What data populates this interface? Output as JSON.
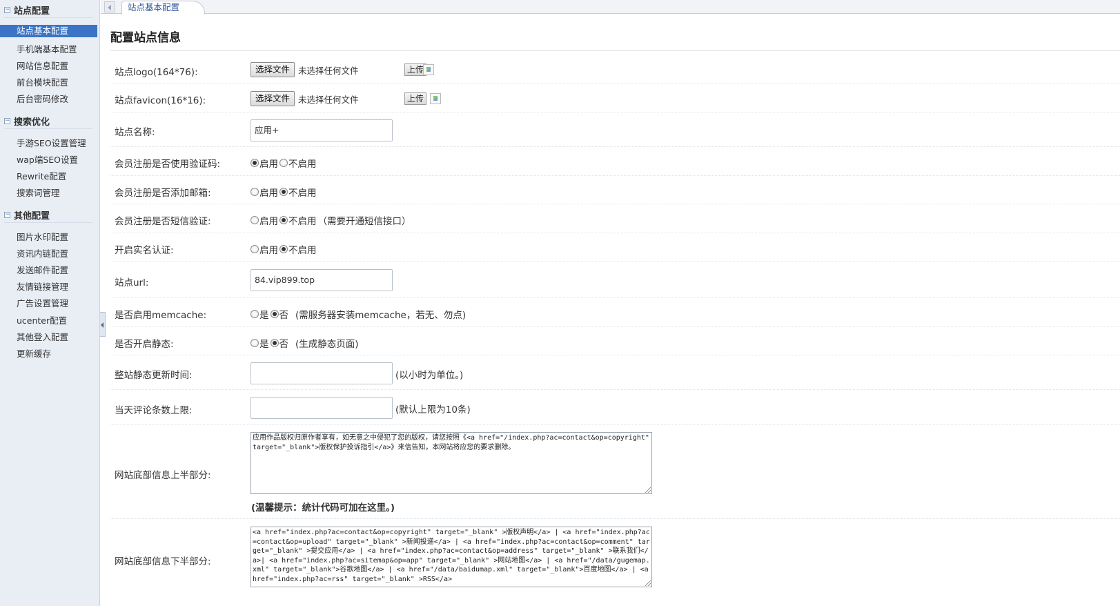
{
  "sidebar": {
    "groups": [
      {
        "title": "站点配置",
        "items": [
          "站点基本配置",
          "手机端基本配置",
          "网站信息配置",
          "前台模块配置",
          "后台密码修改"
        ]
      },
      {
        "title": "搜索优化",
        "items": [
          "手游SEO设置管理",
          "wap端SEO设置",
          "Rewrite配置",
          "搜索词管理"
        ]
      },
      {
        "title": "其他配置",
        "items": [
          "图片水印配置",
          "资讯内链配置",
          "发送邮件配置",
          "友情链接管理",
          "广告设置管理",
          "ucenter配置",
          "其他登入配置",
          "更新缓存"
        ]
      }
    ],
    "active_item": "站点基本配置"
  },
  "tabs": {
    "active": "站点基本配置"
  },
  "page": {
    "title": "配置站点信息"
  },
  "common": {
    "choose_file": "选择文件",
    "no_file": "未选择任何文件",
    "upload": "上传",
    "enable": "启用",
    "disable": "不启用",
    "yes": "是",
    "no": "否"
  },
  "form": {
    "logo": {
      "label": "站点logo(164*76):"
    },
    "favicon": {
      "label": "站点favicon(16*16):"
    },
    "site_name": {
      "label": "站点名称:",
      "value": "应用+"
    },
    "reg_captcha": {
      "label": "会员注册是否使用验证码:",
      "selected": "enable"
    },
    "reg_email": {
      "label": "会员注册是否添加邮箱:",
      "selected": "disable"
    },
    "reg_sms": {
      "label": "会员注册是否短信验证:",
      "selected": "disable",
      "hint": "（需要开通短信接口）"
    },
    "realname": {
      "label": "开启实名认证:",
      "selected": "disable"
    },
    "site_url": {
      "label": "站点url:",
      "value": "84.vip899.top"
    },
    "memcache": {
      "label": "是否启用memcache:",
      "selected": "no",
      "hint": "(需服务器安装memcache，若无、勿点)"
    },
    "static": {
      "label": "是否开启静态:",
      "selected": "no",
      "hint": "(生成静态页面)"
    },
    "static_interval": {
      "label": "整站静态更新时间:",
      "value": "",
      "hint": "(以小时为单位。)"
    },
    "comment_limit": {
      "label": "当天评论条数上限:",
      "value": "",
      "hint": "(默认上限为10条)"
    },
    "footer_top": {
      "label": "网站底部信息上半部分:",
      "value": "应用作品版权归原作者享有，如无意之中侵犯了您的版权，请您按照《<a href=\"/index.php?ac=contact&op=copyright\"  target=\"_blank\">版权保护投诉指引</a>》来信告知，本网站将应您的要求删除。",
      "tip": "(温馨提示：统计代码可加在这里。)"
    },
    "footer_bottom": {
      "label": "网站底部信息下半部分:",
      "value": "<a href=\"index.php?ac=contact&op=copyright\" target=\"_blank\" >版权声明</a> | <a href=\"index.php?ac=contact&op=upload\" target=\"_blank\" >新闻投递</a> | <a href=\"index.php?ac=contact&op=comment\" target=\"_blank\" >提交应用</a> | <a href=\"index.php?ac=contact&op=address\" target=\"_blank\" >联系我们</a>| <a href=\"index.php?ac=sitemap&op=app\" target=\"_blank\" >网站地图</a> | <a href=\"/data/gugemap.xml\" target=\"_blank\">谷歌地图</a> | <a href=\"/data/baidumap.xml\" target=\"_blank\">百度地图</a> | <a href=\"index.php?ac=rss\" target=\"_blank\" >RSS</a>"
    }
  }
}
